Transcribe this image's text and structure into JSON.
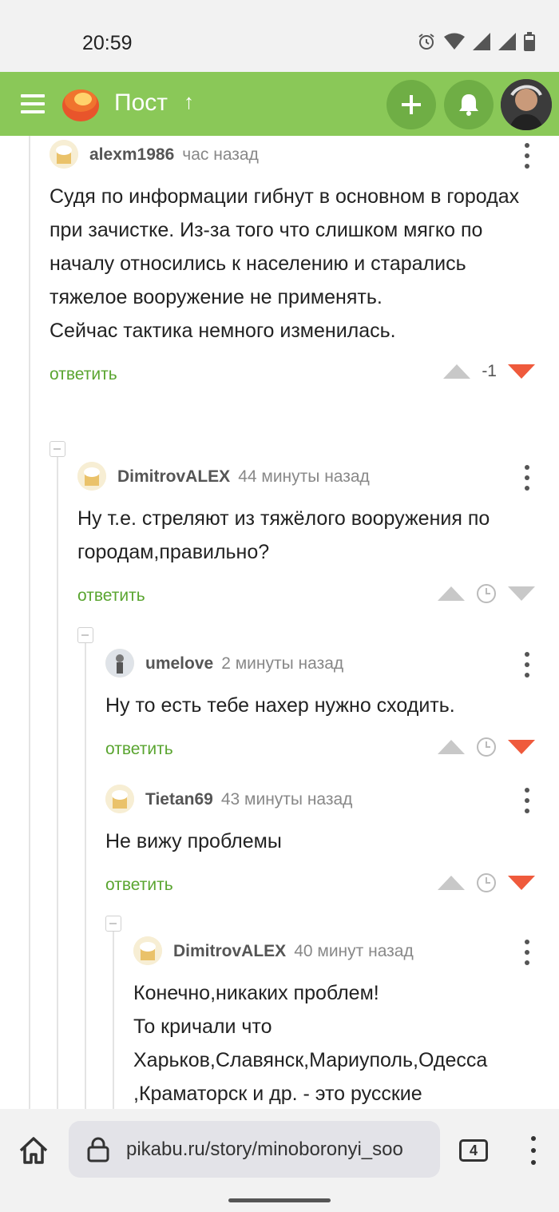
{
  "status_bar": {
    "time": "20:59"
  },
  "header": {
    "title": "Пост",
    "up_glyph": "↑",
    "colors": {
      "bar": "#8ac858",
      "button": "#6fae45"
    }
  },
  "comments": [
    {
      "user": "alexm1986",
      "time": "час назад",
      "text": "Судя по информации гибнут в основном в городах при зачистке.  Из-за того что слишком мягко по началу относились к населению и старались тяжелое вооружение не применять.\nСейчас тактика немного изменилась.",
      "reply": "ответить",
      "score": "-1"
    },
    {
      "user": "DimitrovALEX",
      "time": "44 минуты назад",
      "text": "Ну т.е. стреляют из тяжёлого вооружения по городам,правильно?",
      "reply": "ответить"
    },
    {
      "user": "umelove",
      "time": "2 минуты назад",
      "text": "Ну то есть тебе нахер нужно сходить.",
      "reply": "ответить"
    },
    {
      "user": "Tietan69",
      "time": "43 минуты назад",
      "text": "Не вижу проблемы",
      "reply": "ответить"
    },
    {
      "user": "DimitrovALEX",
      "time": "40 минут назад",
      "text": "Конечно,никаких проблем!\nТо кричали что\nХарьков,Славянск,Мариуполь,Одесса\n,Краматорск и др. - это русские"
    }
  ],
  "browser": {
    "url": "pikabu.ru/story/minoboronyi_soo",
    "tab_count": "4"
  },
  "colors": {
    "reply": "#5aa530",
    "vote_down": "#ef5a3c",
    "vote_neutral": "#c8c8c8"
  }
}
